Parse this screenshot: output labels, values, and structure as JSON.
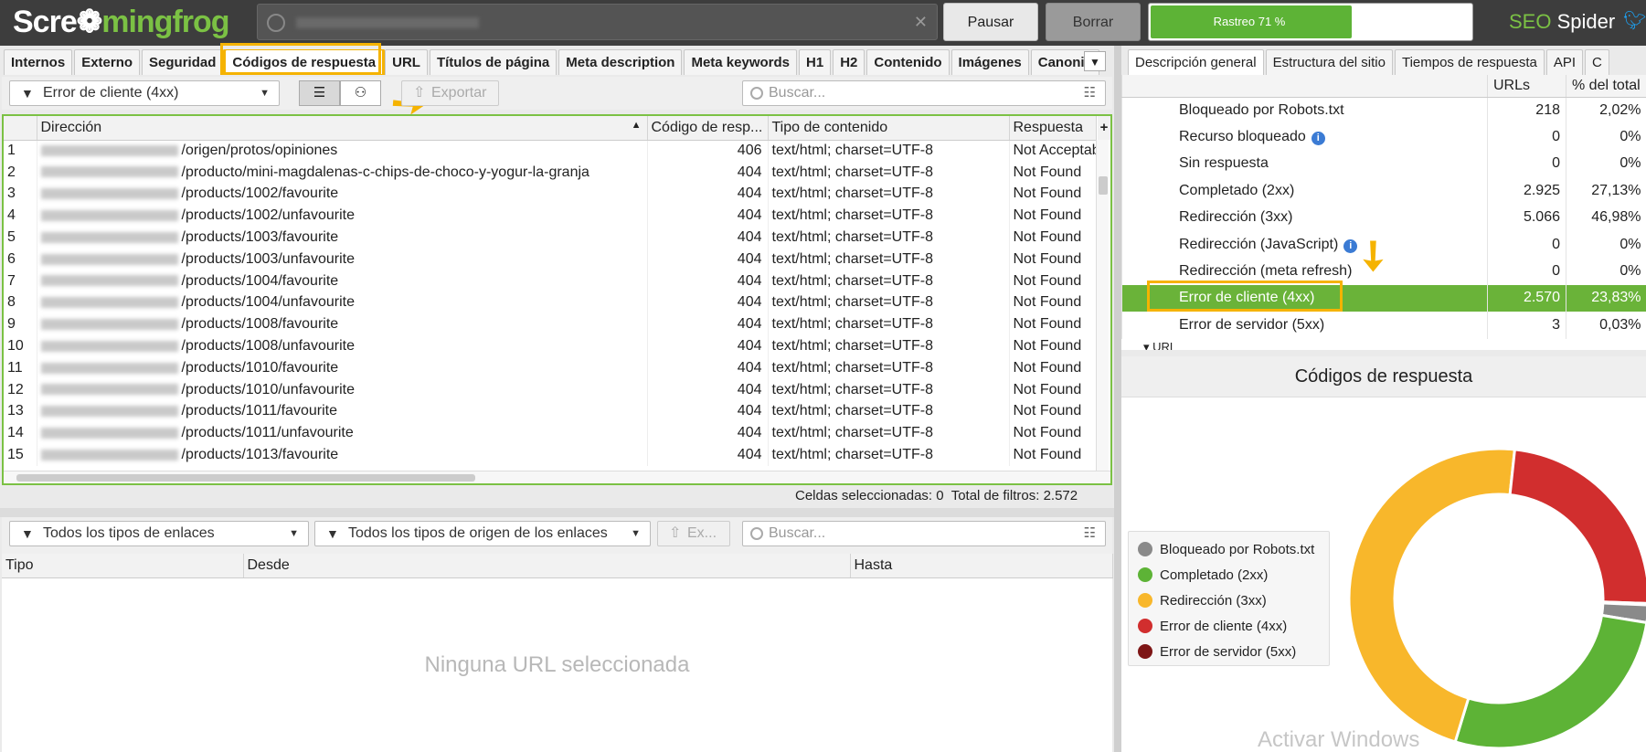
{
  "app": {
    "logo_text_a": "Scre",
    "logo_text_b": "mingfrog",
    "brand_a": "SEO",
    "brand_b": " Spider",
    "pause_label": "Pausar",
    "clear_label": "Borrar",
    "progress_label": "Rastreo 71 %",
    "progress": 0.71,
    "twitter_icon": "twitter-icon"
  },
  "left_tabs": [
    "Internos",
    "Externo",
    "Seguridad",
    "Códigos de respuesta",
    "URL",
    "Títulos de página",
    "Meta description",
    "Meta keywords",
    "H1",
    "H2",
    "Contenido",
    "Imágenes",
    "Canonic"
  ],
  "right_tabs": [
    "Descripción general",
    "Estructura del sitio",
    "Tiempos de respuesta",
    "API",
    "C"
  ],
  "toolbar": {
    "filter_label": "Error de cliente (4xx)",
    "export_label": "Exportar",
    "search_placeholder": "Buscar..."
  },
  "table": {
    "headers": [
      "Dirección",
      "Código de resp...",
      "Tipo de contenido",
      "Respuesta"
    ],
    "rows": [
      {
        "n": "1",
        "path": "/origen/protos/opiniones",
        "code": "406",
        "type": "text/html; charset=UTF-8",
        "resp": "Not Acceptable"
      },
      {
        "n": "2",
        "path": "/producto/mini-magdalenas-c-chips-de-choco-y-yogur-la-granja",
        "code": "404",
        "type": "text/html; charset=UTF-8",
        "resp": "Not Found"
      },
      {
        "n": "3",
        "path": "/products/1002/favourite",
        "code": "404",
        "type": "text/html; charset=UTF-8",
        "resp": "Not Found"
      },
      {
        "n": "4",
        "path": "/products/1002/unfavourite",
        "code": "404",
        "type": "text/html; charset=UTF-8",
        "resp": "Not Found"
      },
      {
        "n": "5",
        "path": "/products/1003/favourite",
        "code": "404",
        "type": "text/html; charset=UTF-8",
        "resp": "Not Found"
      },
      {
        "n": "6",
        "path": "/products/1003/unfavourite",
        "code": "404",
        "type": "text/html; charset=UTF-8",
        "resp": "Not Found"
      },
      {
        "n": "7",
        "path": "/products/1004/favourite",
        "code": "404",
        "type": "text/html; charset=UTF-8",
        "resp": "Not Found"
      },
      {
        "n": "8",
        "path": "/products/1004/unfavourite",
        "code": "404",
        "type": "text/html; charset=UTF-8",
        "resp": "Not Found"
      },
      {
        "n": "9",
        "path": "/products/1008/favourite",
        "code": "404",
        "type": "text/html; charset=UTF-8",
        "resp": "Not Found"
      },
      {
        "n": "10",
        "path": "/products/1008/unfavourite",
        "code": "404",
        "type": "text/html; charset=UTF-8",
        "resp": "Not Found"
      },
      {
        "n": "11",
        "path": "/products/1010/favourite",
        "code": "404",
        "type": "text/html; charset=UTF-8",
        "resp": "Not Found"
      },
      {
        "n": "12",
        "path": "/products/1010/unfavourite",
        "code": "404",
        "type": "text/html; charset=UTF-8",
        "resp": "Not Found"
      },
      {
        "n": "13",
        "path": "/products/1011/favourite",
        "code": "404",
        "type": "text/html; charset=UTF-8",
        "resp": "Not Found"
      },
      {
        "n": "14",
        "path": "/products/1011/unfavourite",
        "code": "404",
        "type": "text/html; charset=UTF-8",
        "resp": "Not Found"
      },
      {
        "n": "15",
        "path": "/products/1013/favourite",
        "code": "404",
        "type": "text/html; charset=UTF-8",
        "resp": "Not Found"
      }
    ]
  },
  "status": {
    "selected_label": "Celdas seleccionadas:",
    "selected_value": "0",
    "filters_label": "Total de filtros:",
    "filters_value": "2.572"
  },
  "bottom": {
    "link_type_filter": "Todos los tipos de enlaces",
    "origin_type_filter": "Todos los tipos de origen de los enlaces",
    "export_label": "Ex...",
    "search_placeholder": "Buscar...",
    "headers": [
      "Tipo",
      "Desde",
      "Hasta"
    ],
    "empty_message": "Ninguna URL seleccionada"
  },
  "summary": {
    "headers": [
      "",
      "URLs",
      "% del total"
    ],
    "rows": [
      {
        "label": "Bloqueado por Robots.txt",
        "urls": "218",
        "pct": "2,02%",
        "info": false
      },
      {
        "label": "Recurso bloqueado",
        "urls": "0",
        "pct": "0%",
        "info": true
      },
      {
        "label": "Sin respuesta",
        "urls": "0",
        "pct": "0%",
        "info": false
      },
      {
        "label": "Completado (2xx)",
        "urls": "2.925",
        "pct": "27,13%",
        "info": false
      },
      {
        "label": "Redirección (3xx)",
        "urls": "5.066",
        "pct": "46,98%",
        "info": false
      },
      {
        "label": "Redirección (JavaScript)",
        "urls": "0",
        "pct": "0%",
        "info": true
      },
      {
        "label": "Redirección (meta refresh)",
        "urls": "0",
        "pct": "0%",
        "info": false
      },
      {
        "label": "Error de cliente (4xx)",
        "urls": "2.570",
        "pct": "23,83%",
        "info": false
      },
      {
        "label": "Error de servidor (5xx)",
        "urls": "3",
        "pct": "0,03%",
        "info": false
      }
    ],
    "highlighted_index": 7,
    "partial_row": "URL"
  },
  "chart_title": "Códigos de respuesta",
  "chart_data": {
    "type": "pie",
    "title": "Códigos de respuesta",
    "series": [
      {
        "name": "Bloqueado por Robots.txt",
        "value": 218,
        "color": "#8a8a8a"
      },
      {
        "name": "Completado (2xx)",
        "value": 2925,
        "color": "#5db336"
      },
      {
        "name": "Redirección (3xx)",
        "value": 5066,
        "color": "#f8b72b"
      },
      {
        "name": "Error de cliente (4xx)",
        "value": 2570,
        "color": "#d12e2e"
      },
      {
        "name": "Error de servidor (5xx)",
        "value": 3,
        "color": "#7e1616"
      }
    ],
    "donut": true,
    "legend": "left"
  },
  "watermark": "Activar Windows"
}
